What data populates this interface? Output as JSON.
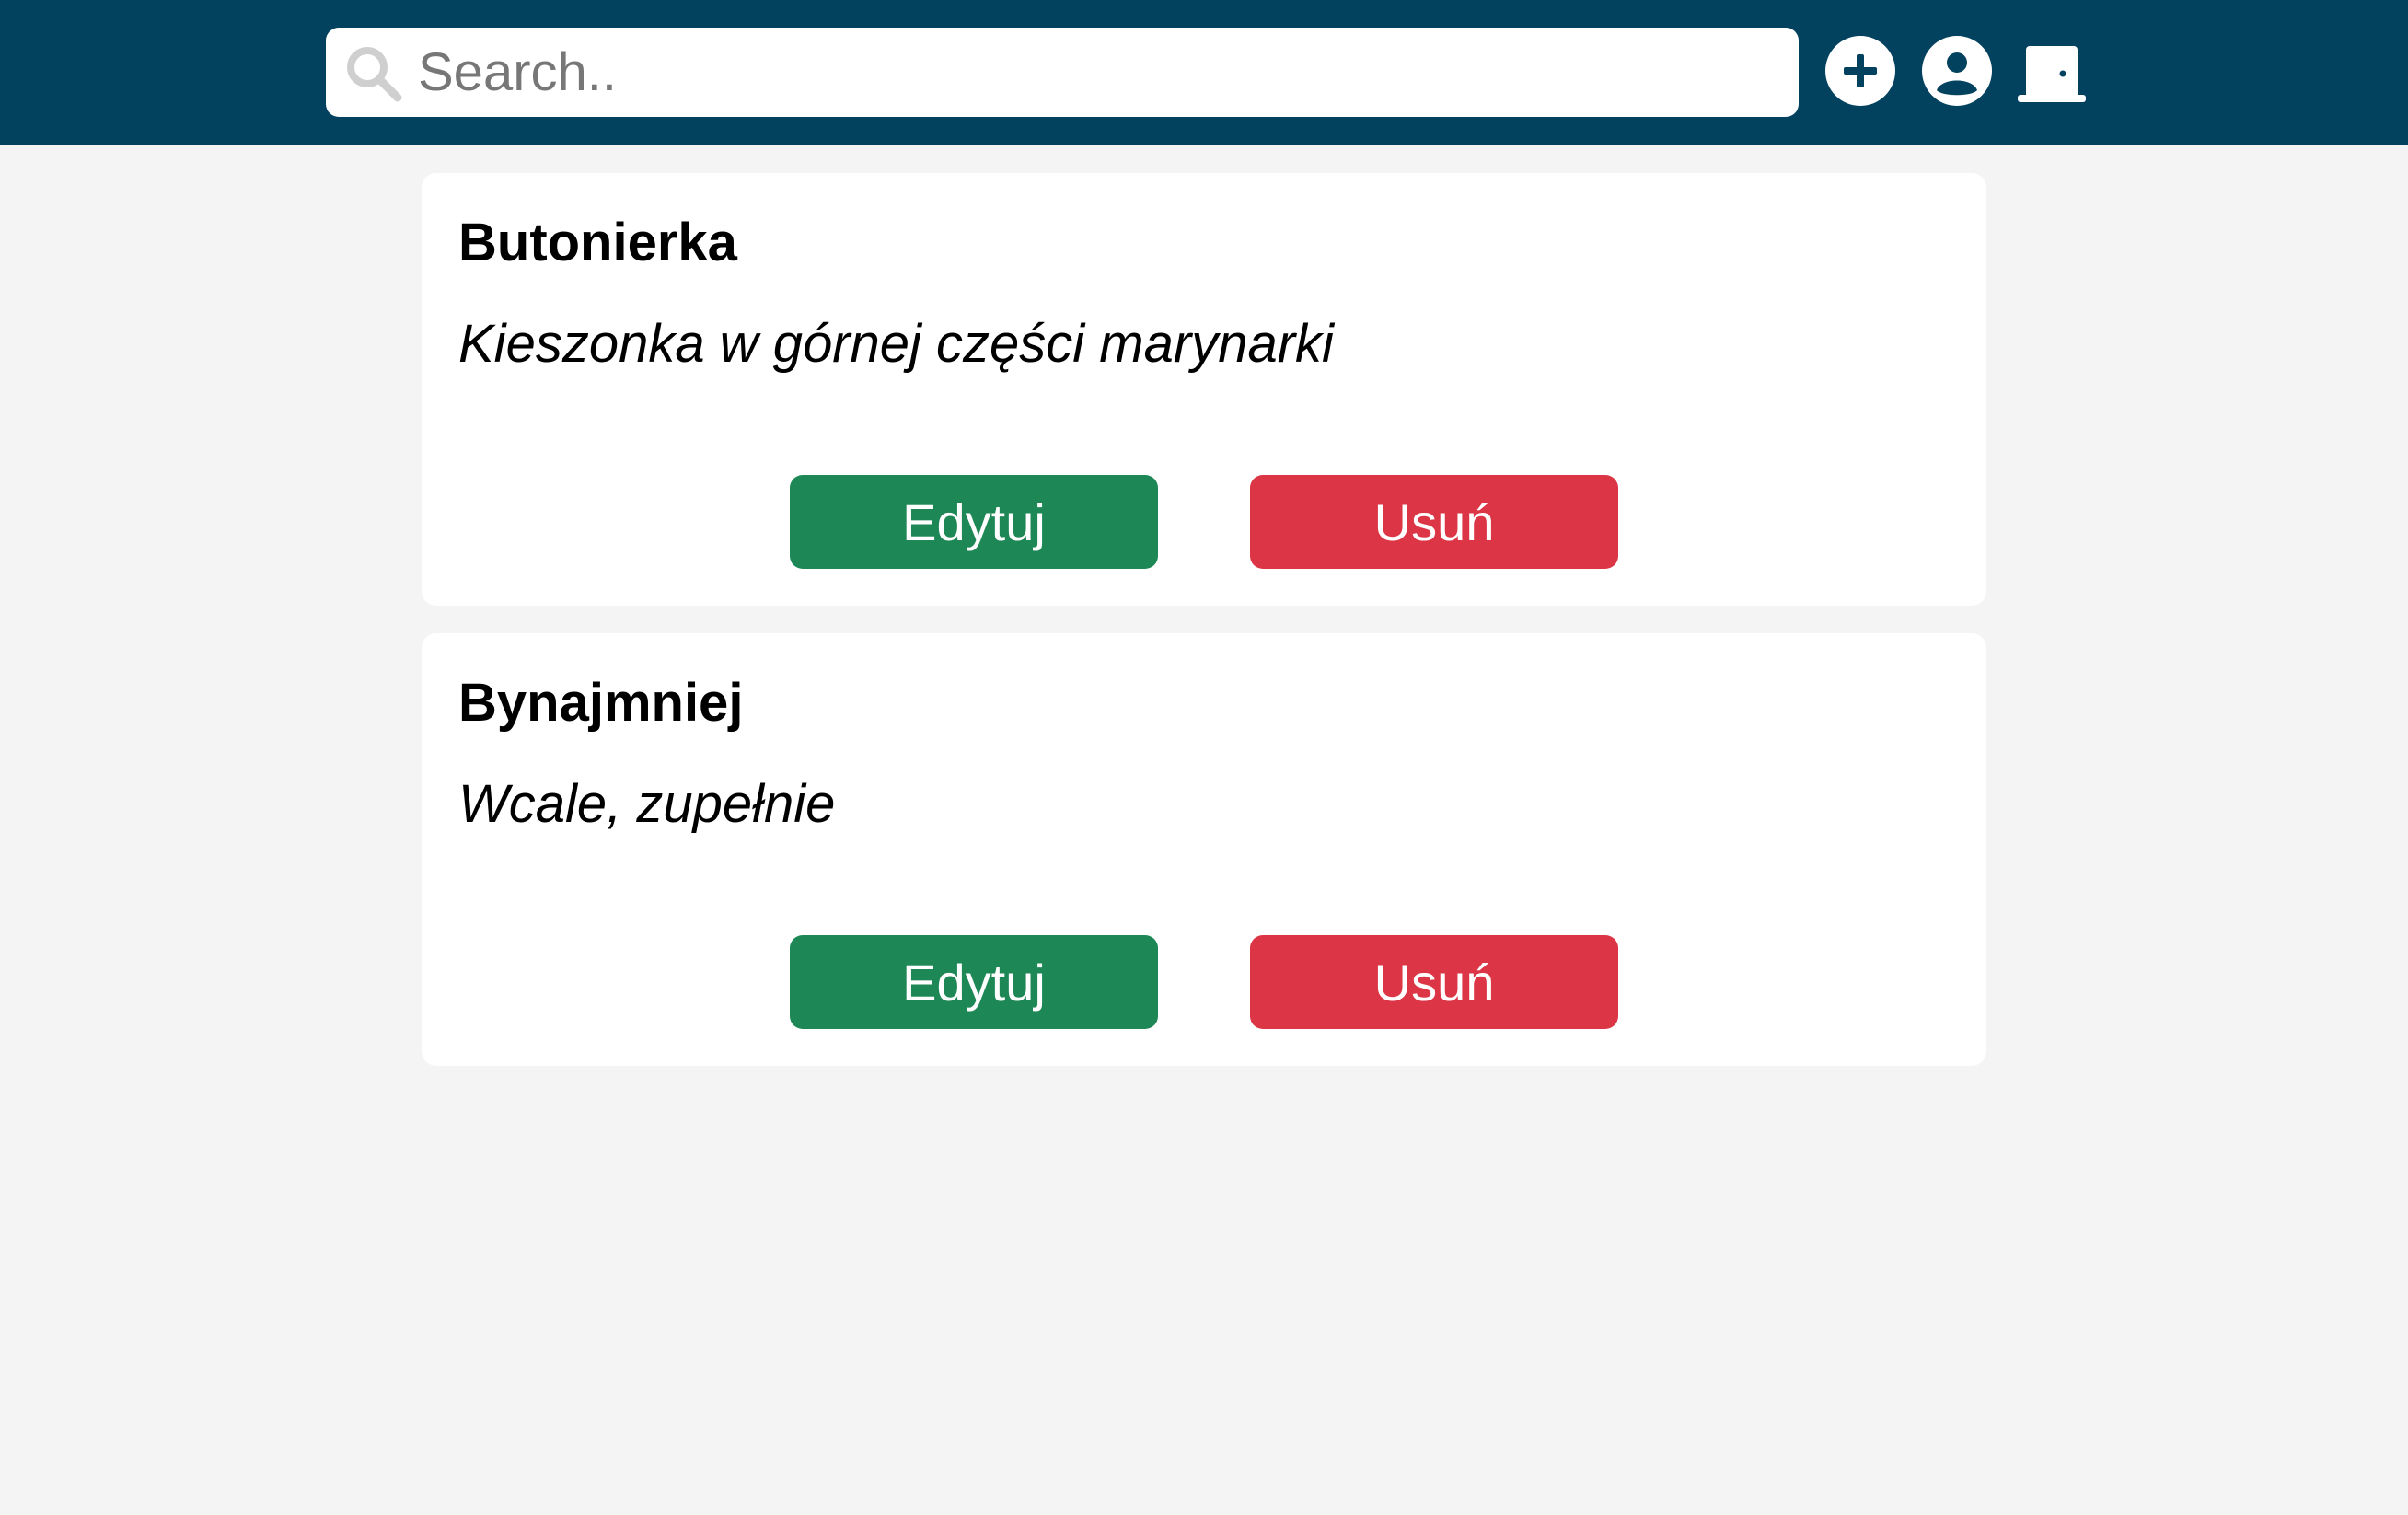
{
  "header": {
    "search": {
      "placeholder": "Search..",
      "value": ""
    },
    "icons": {
      "search": "search-icon",
      "add": "plus-circle-icon",
      "user": "user-circle-icon",
      "logout": "door-icon"
    }
  },
  "entries": [
    {
      "term": "Butonierka",
      "definition": "Kieszonka w górnej części marynarki",
      "edit_label": "Edytuj",
      "delete_label": "Usuń"
    },
    {
      "term": "Bynajmniej",
      "definition": "Wcale, zupełnie",
      "edit_label": "Edytuj",
      "delete_label": "Usuń"
    }
  ],
  "colors": {
    "header_bg": "#03425e",
    "page_bg": "#f4f4f4",
    "edit_button": "#1d8856",
    "delete_button": "#dc3545"
  }
}
